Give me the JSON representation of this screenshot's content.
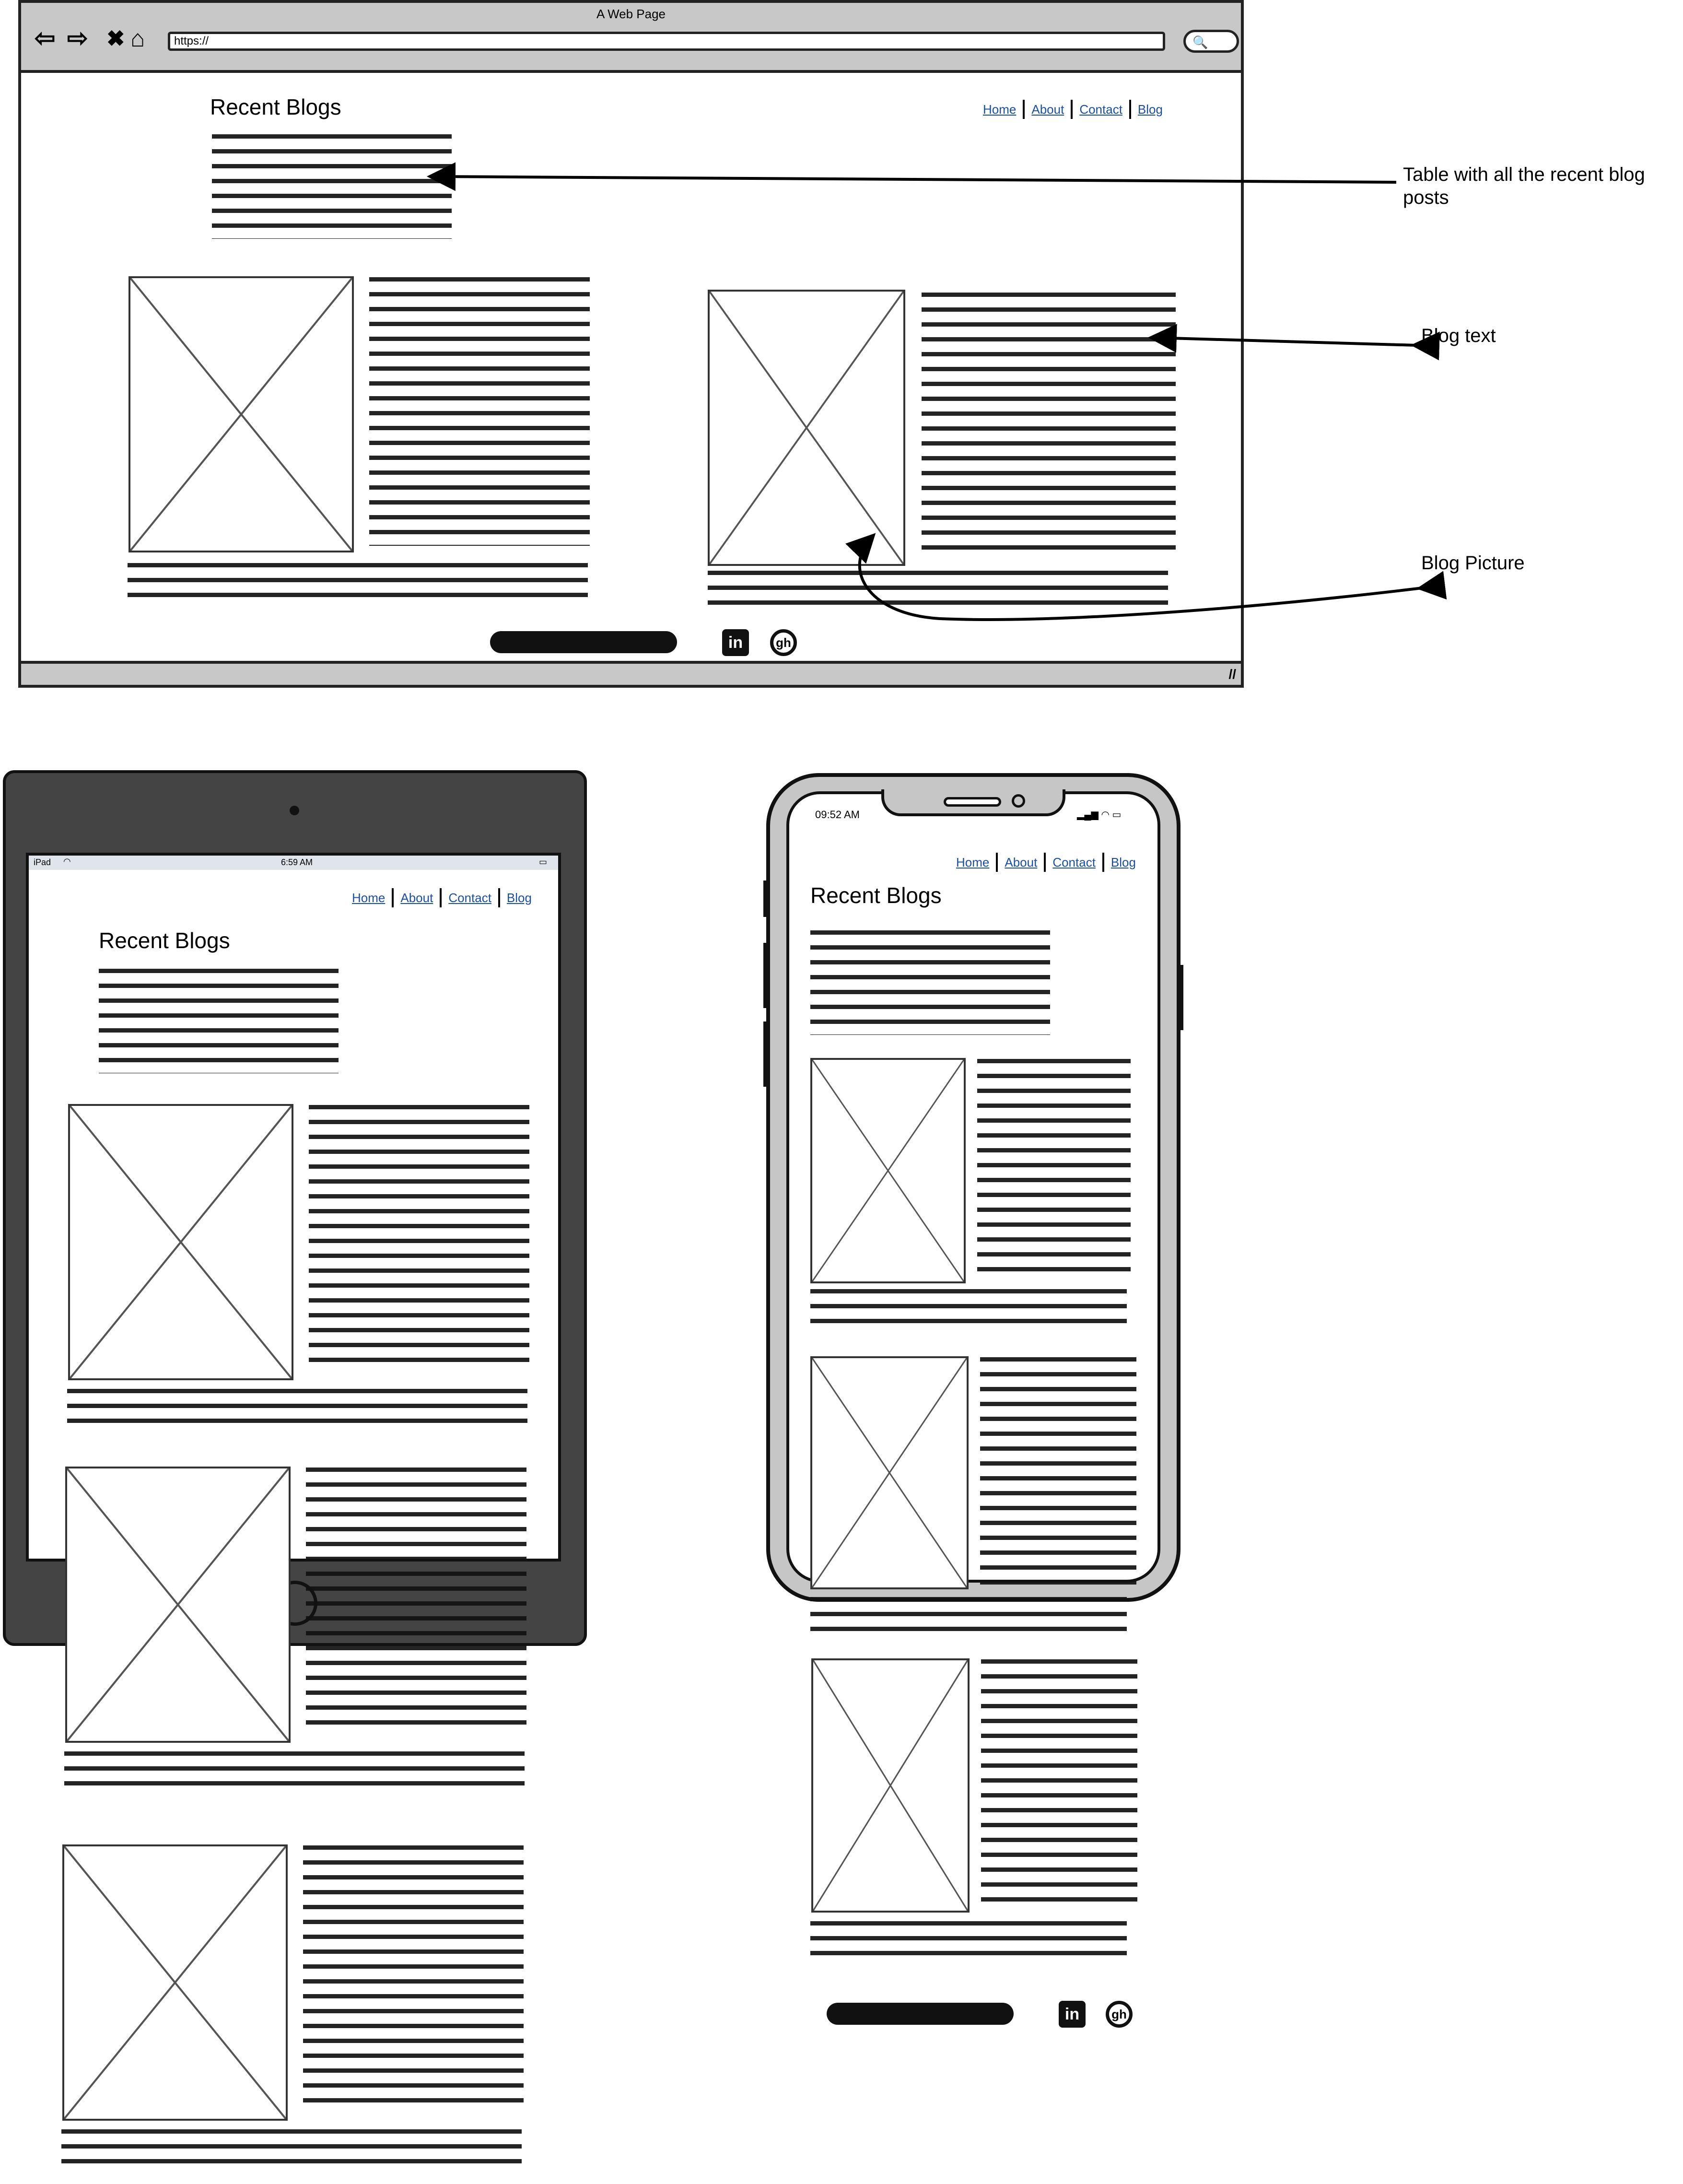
{
  "browser": {
    "window_title": "A Web Page",
    "url": "https://",
    "nav_icons": [
      "back-icon",
      "forward-icon",
      "close-icon",
      "home-icon"
    ],
    "search_icon": "search-icon"
  },
  "site": {
    "title": "Recent Blogs",
    "nav": [
      "Home",
      "About",
      "Contact",
      "Blog"
    ],
    "social_icons": [
      "linkedin-icon",
      "github-icon"
    ],
    "linkedin_glyph": "in",
    "github_glyph": "gh"
  },
  "annotations": {
    "table": "Table with all the recent blog posts",
    "blog_text": "Blog text",
    "blog_picture": "Blog Picture"
  },
  "tablet": {
    "status_left": "iPad",
    "status_time": "6:59 AM"
  },
  "phone": {
    "status_time": "09:52 AM"
  }
}
